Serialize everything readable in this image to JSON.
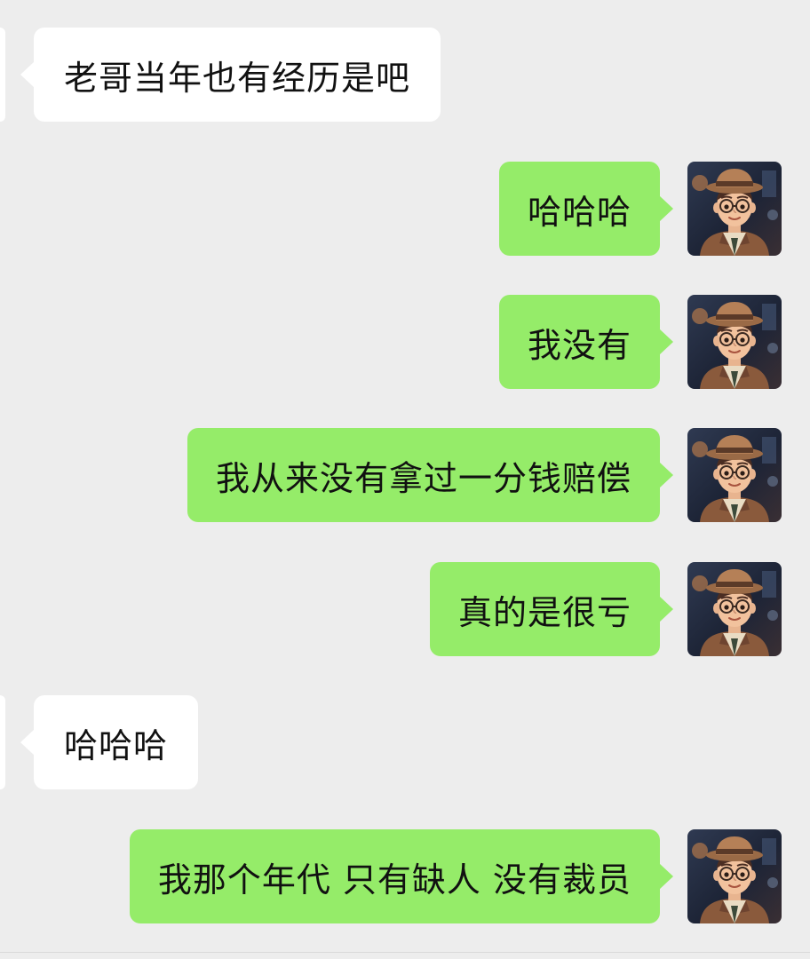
{
  "chat": {
    "messages": [
      {
        "side": "incoming",
        "text": "老哥当年也有经历是吧"
      },
      {
        "side": "outgoing",
        "text": "哈哈哈"
      },
      {
        "side": "outgoing",
        "text": "我没有"
      },
      {
        "side": "outgoing",
        "text": "我从来没有拿过一分钱赔偿"
      },
      {
        "side": "outgoing",
        "text": "真的是很亏"
      },
      {
        "side": "incoming",
        "text": "哈哈哈"
      },
      {
        "side": "outgoing",
        "text": "我那个年代 只有缺人 没有裁员"
      }
    ]
  },
  "colors": {
    "background": "#ededed",
    "incoming_bubble": "#ffffff",
    "outgoing_bubble": "#95ec69",
    "text": "#111111"
  },
  "icons": {
    "self_avatar": "cartoon-man-with-hat-and-glasses-avatar"
  }
}
